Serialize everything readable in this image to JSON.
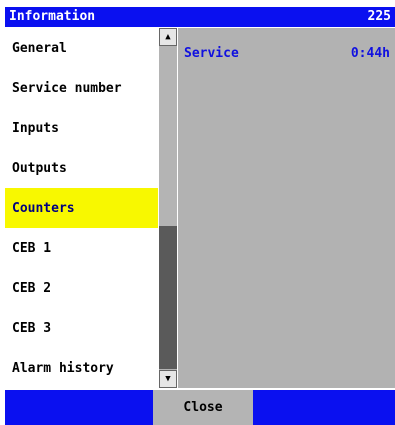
{
  "window": {
    "title": "Information",
    "number": "225"
  },
  "menu": {
    "items": [
      {
        "label": "General"
      },
      {
        "label": "Service number"
      },
      {
        "label": "Inputs"
      },
      {
        "label": "Outputs"
      },
      {
        "label": "Counters",
        "selected": true
      },
      {
        "label": "CEB 1"
      },
      {
        "label": "CEB 2"
      },
      {
        "label": "CEB 3"
      },
      {
        "label": "Alarm history"
      }
    ]
  },
  "scrollbar": {
    "up_icon": "arrow-up-icon",
    "down_icon": "arrow-down-icon"
  },
  "content": {
    "rows": [
      {
        "label": "Service",
        "value": "0:44h"
      }
    ]
  },
  "footer": {
    "close_label": "Close"
  },
  "colors": {
    "title_bar": "#0a10f0",
    "selected_item": "#f8f800",
    "content_bg": "#b2b2b2",
    "value_text": "#1010e0"
  }
}
